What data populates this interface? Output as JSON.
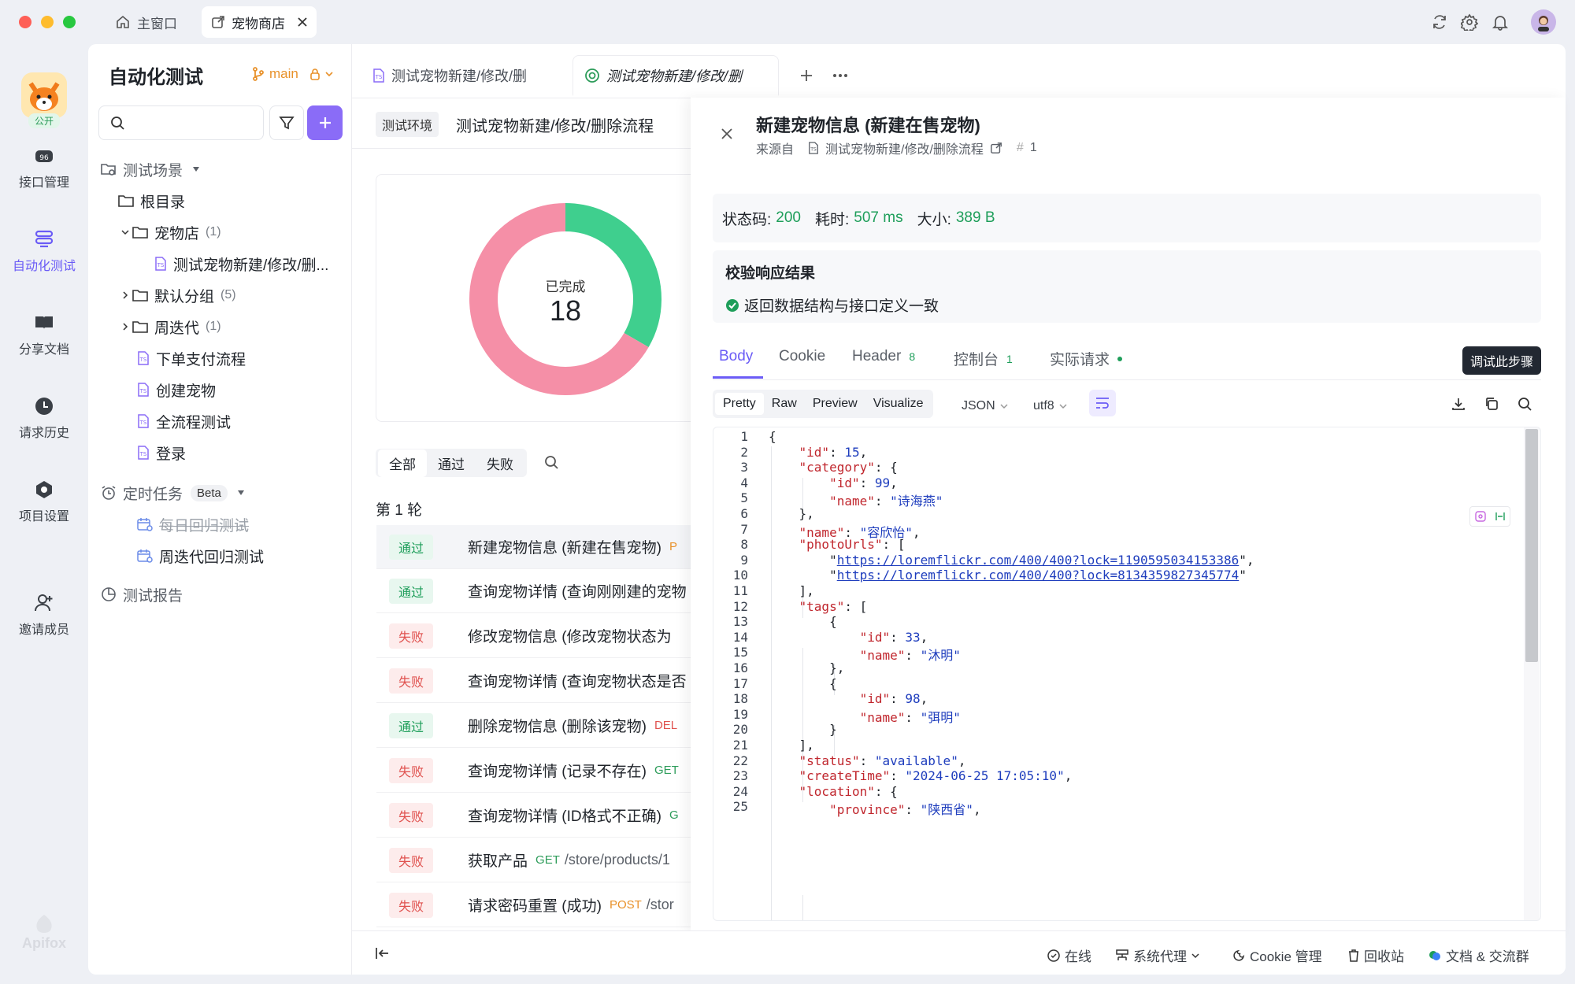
{
  "titlebar": {
    "tabs": [
      {
        "label": "主窗口",
        "icon": "home-icon"
      },
      {
        "label": "宠物商店",
        "icon": "external-link-icon"
      }
    ]
  },
  "rail": {
    "public_badge": "公开",
    "items": [
      {
        "label": "接口管理",
        "icon": "api-icon"
      },
      {
        "label": "自动化测试",
        "icon": "automation-icon"
      },
      {
        "label": "分享文档",
        "icon": "book-icon"
      },
      {
        "label": "请求历史",
        "icon": "clock-icon"
      },
      {
        "label": "项目设置",
        "icon": "settings-icon"
      },
      {
        "label": "邀请成员",
        "icon": "add-user-icon"
      }
    ],
    "brand": "Apifox"
  },
  "sidebar": {
    "title": "自动化测试",
    "branch": "main",
    "search_placeholder": "",
    "tree": {
      "scenarios": "测试场景",
      "root": "根目录",
      "petshop": "宠物店",
      "petshop_count": "(1)",
      "petshop_child": "测试宠物新建/修改/删...",
      "default_group": "默认分组",
      "default_count": "(5)",
      "weekly": "周迭代",
      "weekly_count": "(1)",
      "order": "下单支付流程",
      "create_pet": "创建宠物",
      "full_flow": "全流程测试",
      "login": "登录",
      "scheduled": "定时任务",
      "beta": "Beta",
      "daily": "每日回归测试",
      "weekly_regress": "周迭代回归测试",
      "reports": "测试报告"
    }
  },
  "main": {
    "tabs": [
      "测试宠物新建/修改/删",
      "测试宠物新建/修改/删"
    ],
    "env_tag": "测试环境",
    "scenario_title": "测试宠物新建/修改/删除流程",
    "donut": {
      "label": "已完成",
      "value": "18",
      "passed": 6,
      "failed": 12,
      "pass_color": "#3fcf8e",
      "fail_color": "#f58fa7"
    },
    "filters": [
      "全部",
      "通过",
      "失败"
    ],
    "round": "第 1 轮",
    "rows": [
      {
        "status": "通过",
        "name": "新建宠物信息 (新建在售宠物)",
        "method": "P"
      },
      {
        "status": "通过",
        "name": "查询宠物详情 (查询刚刚建的宠物",
        "method": ""
      },
      {
        "status": "失败",
        "name": "修改宠物信息 (修改宠物状态为",
        "method": ""
      },
      {
        "status": "失败",
        "name": "查询宠物详情 (查询宠物状态是否",
        "method": ""
      },
      {
        "status": "通过",
        "name": "删除宠物信息 (删除该宠物)",
        "method": "DEL"
      },
      {
        "status": "失败",
        "name": "查询宠物详情 (记录不存在)",
        "method": "GET"
      },
      {
        "status": "失败",
        "name": "查询宠物详情 (ID格式不正确)",
        "method": "G"
      },
      {
        "status": "失败",
        "name": "获取产品",
        "method": "GET",
        "path": "/store/products/1"
      },
      {
        "status": "失败",
        "name": "请求密码重置 (成功)",
        "method": "POST",
        "path": "/stor"
      }
    ]
  },
  "panel": {
    "title": "新建宠物信息 (新建在售宠物)",
    "source_label": "来源自",
    "source_name": "测试宠物新建/修改/删除流程",
    "source_index": "1",
    "status_label": "状态码:",
    "status_value": "200",
    "time_label": "耗时:",
    "time_value": "507 ms",
    "size_label": "大小:",
    "size_value": "389 B",
    "validate_title": "校验响应结果",
    "validate_msg": "返回数据结构与接口定义一致",
    "tabs": [
      {
        "label": "Body"
      },
      {
        "label": "Cookie"
      },
      {
        "label": "Header",
        "count": "8"
      },
      {
        "label": "控制台",
        "count": "1"
      },
      {
        "label": "实际请求"
      }
    ],
    "debug_btn": "调试此步骤",
    "view_modes": [
      "Pretty",
      "Raw",
      "Preview",
      "Visualize"
    ],
    "format": "JSON",
    "encoding": "utf8",
    "code_lines": [
      "{",
      "    \"id\": 15,",
      "    \"category\": {",
      "        \"id\": 99,",
      "        \"name\": \"诗海燕\"",
      "    },",
      "    \"name\": \"容欣怡\",",
      "    \"photoUrls\": [",
      "        \"https://loremflickr.com/400/400?lock=1190595034153386\",",
      "        \"https://loremflickr.com/400/400?lock=8134359827345774\"",
      "    ],",
      "    \"tags\": [",
      "        {",
      "            \"id\": 33,",
      "            \"name\": \"沐明\"",
      "        },",
      "        {",
      "            \"id\": 98,",
      "            \"name\": \"弭明\"",
      "        }",
      "    ],",
      "    \"status\": \"available\",",
      "    \"createTime\": \"2024-06-25 17:05:10\",",
      "    \"location\": {",
      "        \"province\": \"陕西省\","
    ]
  },
  "statusbar": {
    "online": "在线",
    "proxy": "系统代理",
    "cookie": "Cookie 管理",
    "trash": "回收站",
    "docs": "文档 & 交流群"
  }
}
